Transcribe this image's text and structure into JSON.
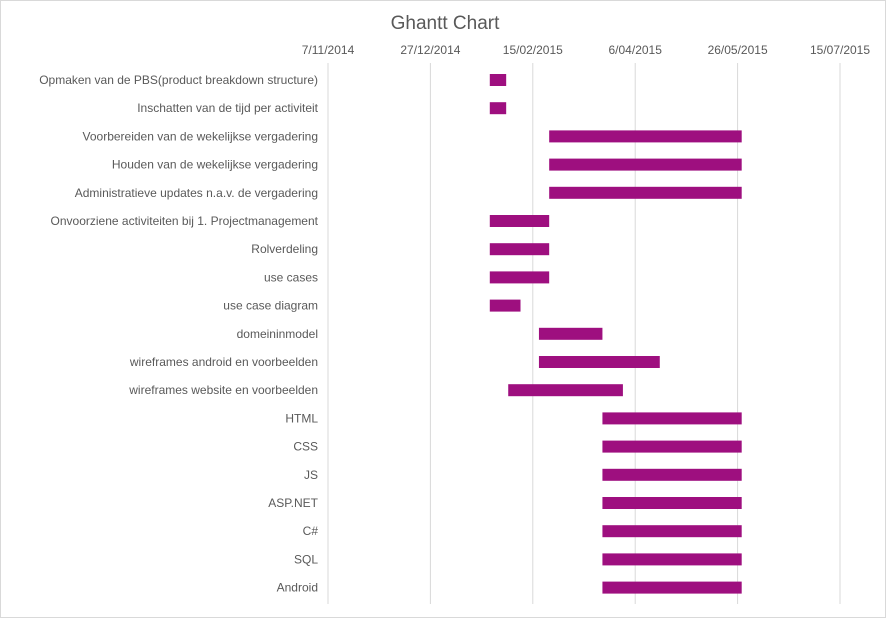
{
  "chart_data": {
    "type": "bar",
    "orientation": "horizontal",
    "stacked": "gantt",
    "title": "Ghantt Chart",
    "bar_color": "#9e0f7f",
    "x_axis": {
      "position": "top",
      "ticks": [
        "7/11/2014",
        "27/12/2014",
        "15/02/2015",
        "6/04/2015",
        "26/05/2015",
        "15/07/2015"
      ],
      "grid": true
    },
    "tasks": [
      {
        "label": "Opmaken van de PBS(product breakdown structure)",
        "start": "2015-01-25",
        "end": "2015-02-02"
      },
      {
        "label": "Inschatten van de tijd per activiteit",
        "start": "2015-01-25",
        "end": "2015-02-02"
      },
      {
        "label": "Voorbereiden van de wekelijkse vergadering",
        "start": "2015-02-23",
        "end": "2015-05-28"
      },
      {
        "label": "Houden van de wekelijkse vergadering",
        "start": "2015-02-23",
        "end": "2015-05-28"
      },
      {
        "label": "Administratieve updates n.a.v. de vergadering",
        "start": "2015-02-23",
        "end": "2015-05-28"
      },
      {
        "label": "Onvoorziene activiteiten bij 1. Projectmanagement",
        "start": "2015-01-25",
        "end": "2015-02-23"
      },
      {
        "label": "Rolverdeling",
        "start": "2015-01-25",
        "end": "2015-02-23"
      },
      {
        "label": "use cases",
        "start": "2015-01-25",
        "end": "2015-02-23"
      },
      {
        "label": "use case diagram",
        "start": "2015-01-25",
        "end": "2015-02-09"
      },
      {
        "label": "domeininmodel",
        "start": "2015-02-18",
        "end": "2015-03-21"
      },
      {
        "label": "wireframes android en voorbeelden",
        "start": "2015-02-18",
        "end": "2015-04-18"
      },
      {
        "label": "wireframes website en voorbeelden",
        "start": "2015-02-03",
        "end": "2015-03-31"
      },
      {
        "label": "HTML",
        "start": "2015-03-21",
        "end": "2015-05-28"
      },
      {
        "label": "CSS",
        "start": "2015-03-21",
        "end": "2015-05-28"
      },
      {
        "label": "JS",
        "start": "2015-03-21",
        "end": "2015-05-28"
      },
      {
        "label": "ASP.NET",
        "start": "2015-03-21",
        "end": "2015-05-28"
      },
      {
        "label": "C#",
        "start": "2015-03-21",
        "end": "2015-05-28"
      },
      {
        "label": "SQL",
        "start": "2015-03-21",
        "end": "2015-05-28"
      },
      {
        "label": "Android",
        "start": "2015-03-21",
        "end": "2015-05-28"
      }
    ]
  }
}
